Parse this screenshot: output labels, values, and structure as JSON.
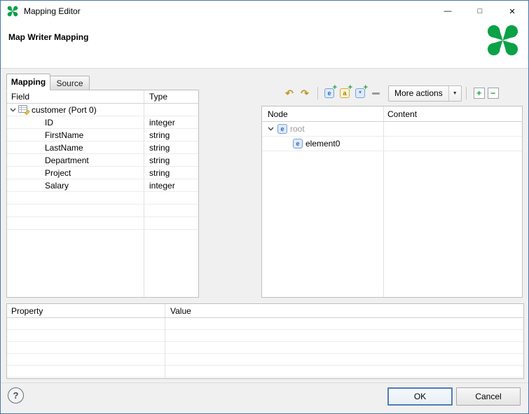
{
  "window": {
    "title": "Mapping Editor",
    "minimize_glyph": "—",
    "maximize_glyph": "□",
    "close_glyph": "×"
  },
  "header": {
    "title": "Map Writer Mapping"
  },
  "tabs": {
    "mapping": "Mapping",
    "source": "Source"
  },
  "field_table": {
    "columns": {
      "field": "Field",
      "type": "Type"
    },
    "root_label": "customer (Port 0)",
    "rows": [
      {
        "field": "ID",
        "type": "integer"
      },
      {
        "field": "FirstName",
        "type": "string"
      },
      {
        "field": "LastName",
        "type": "string"
      },
      {
        "field": "Department",
        "type": "string"
      },
      {
        "field": "Project",
        "type": "string"
      },
      {
        "field": "Salary",
        "type": "integer"
      }
    ]
  },
  "toolbar": {
    "more_actions": "More actions"
  },
  "node_table": {
    "columns": {
      "node": "Node",
      "content": "Content"
    },
    "rows": [
      {
        "label": "root"
      },
      {
        "label": "element0"
      }
    ]
  },
  "property_table": {
    "columns": {
      "property": "Property",
      "value": "Value"
    }
  },
  "footer": {
    "help": "?",
    "ok": "OK",
    "cancel": "Cancel"
  },
  "icons": {
    "map_arrow": "↶",
    "unmap_arrow": "↷",
    "element_glyph": "e",
    "attribute_glyph": "a",
    "wildcard_glyph": "*",
    "plus_glyph": "+",
    "minus_glyph": "−",
    "dropdown_arrow": "▼"
  },
  "colors": {
    "accent_green": "#0aa147",
    "focus_blue": "#0078d7"
  }
}
